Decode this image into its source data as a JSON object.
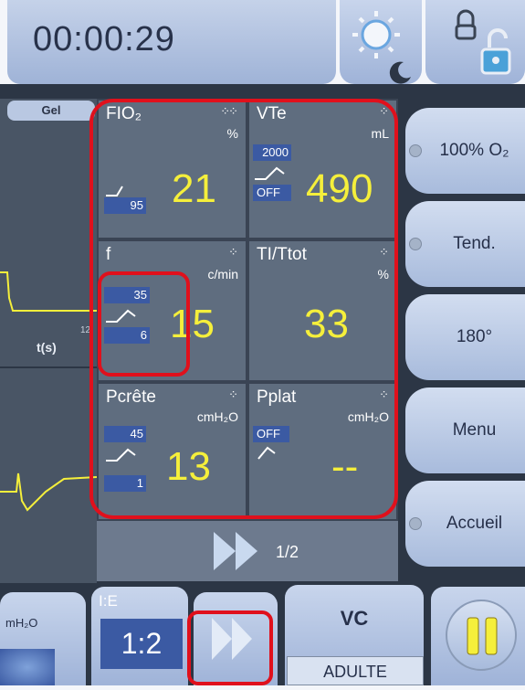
{
  "header": {
    "time": "00:00:29"
  },
  "graph": {
    "tab_label": "Gel",
    "axis_label": "t(s)",
    "tick": "12"
  },
  "params": {
    "fio2": {
      "name": "FIO₂",
      "unit": "%",
      "value": "21",
      "low_limit": "95"
    },
    "vte": {
      "name": "VTe",
      "unit": "mL",
      "value": "490",
      "high_limit": "2000",
      "low_limit": "OFF"
    },
    "f": {
      "name": "f",
      "unit": "c/min",
      "value": "15",
      "high_limit": "35",
      "low_limit": "6"
    },
    "titot": {
      "name": "TI/Ttot",
      "unit": "%",
      "value": "33"
    },
    "pcrete": {
      "name": "Pcrête",
      "unit": "cmH₂O",
      "value": "13",
      "high_limit": "45",
      "low_limit": "1"
    },
    "pplat": {
      "name": "Pplat",
      "unit": "cmH₂O",
      "value": "--",
      "high_limit": "OFF"
    }
  },
  "pager": {
    "label": "1/2"
  },
  "right_buttons": {
    "o2": "100% O₂",
    "tend": "Tend.",
    "rotate": "180°",
    "menu": "Menu",
    "home": "Accueil"
  },
  "bottom": {
    "pressure_unit": "mH₂O",
    "ie_label": "I:E",
    "ie_value": "1:2",
    "mode": "VC",
    "patient": "ADULTE"
  },
  "colors": {
    "value_yellow": "#f5ef3b",
    "limit_blue": "#3b5aa3",
    "highlight_red": "#e0101c"
  }
}
